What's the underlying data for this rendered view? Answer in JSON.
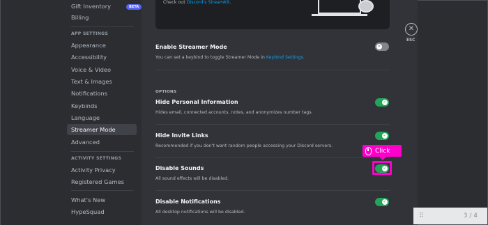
{
  "sidebar": {
    "items_top": [
      {
        "label": "Gift Inventory",
        "badge": "BETA"
      },
      {
        "label": "Billing"
      }
    ],
    "app_settings_header": "APP SETTINGS",
    "app_settings": [
      {
        "label": "Appearance"
      },
      {
        "label": "Accessibility"
      },
      {
        "label": "Voice & Video"
      },
      {
        "label": "Text & Images"
      },
      {
        "label": "Notifications"
      },
      {
        "label": "Keybinds"
      },
      {
        "label": "Language"
      },
      {
        "label": "Streamer Mode",
        "active": true
      },
      {
        "label": "Advanced"
      }
    ],
    "activity_header": "ACTIVITY SETTINGS",
    "activity_settings": [
      {
        "label": "Activity Privacy"
      },
      {
        "label": "Registered Games"
      }
    ],
    "bottom": [
      {
        "label": "What's New"
      },
      {
        "label": "HypeSquad"
      }
    ]
  },
  "preview": {
    "text_prefix": "Check out ",
    "link": "Discord's StreamKit."
  },
  "enable_streamer": {
    "title": "Enable Streamer Mode",
    "desc_prefix": "You can set a keybind to toggle Streamer Mode in ",
    "desc_link": "Keybind Settings.",
    "state": "off"
  },
  "options_label": "OPTIONS",
  "options": [
    {
      "title": "Hide Personal Information",
      "desc": "Hides email, connected accounts, notes, and anonymizes number tags.",
      "state": "on"
    },
    {
      "title": "Hide Invite Links",
      "desc": "Recommended if you don't want random people accessing your Discord servers.",
      "state": "on"
    },
    {
      "title": "Disable Sounds",
      "desc": "All sound effects will be disabled.",
      "state": "on"
    },
    {
      "title": "Disable Notifications",
      "desc": "All desktop notifications will be disabled.",
      "state": "on"
    }
  ],
  "close": {
    "label": "ESC"
  },
  "click_hint": {
    "label": "Click"
  },
  "pager": {
    "count": "3 / 4"
  },
  "colors": {
    "toggle_on": "#23a559",
    "toggle_off": "#80848e",
    "highlight": "#ff00cc",
    "link": "#00a8fc"
  }
}
